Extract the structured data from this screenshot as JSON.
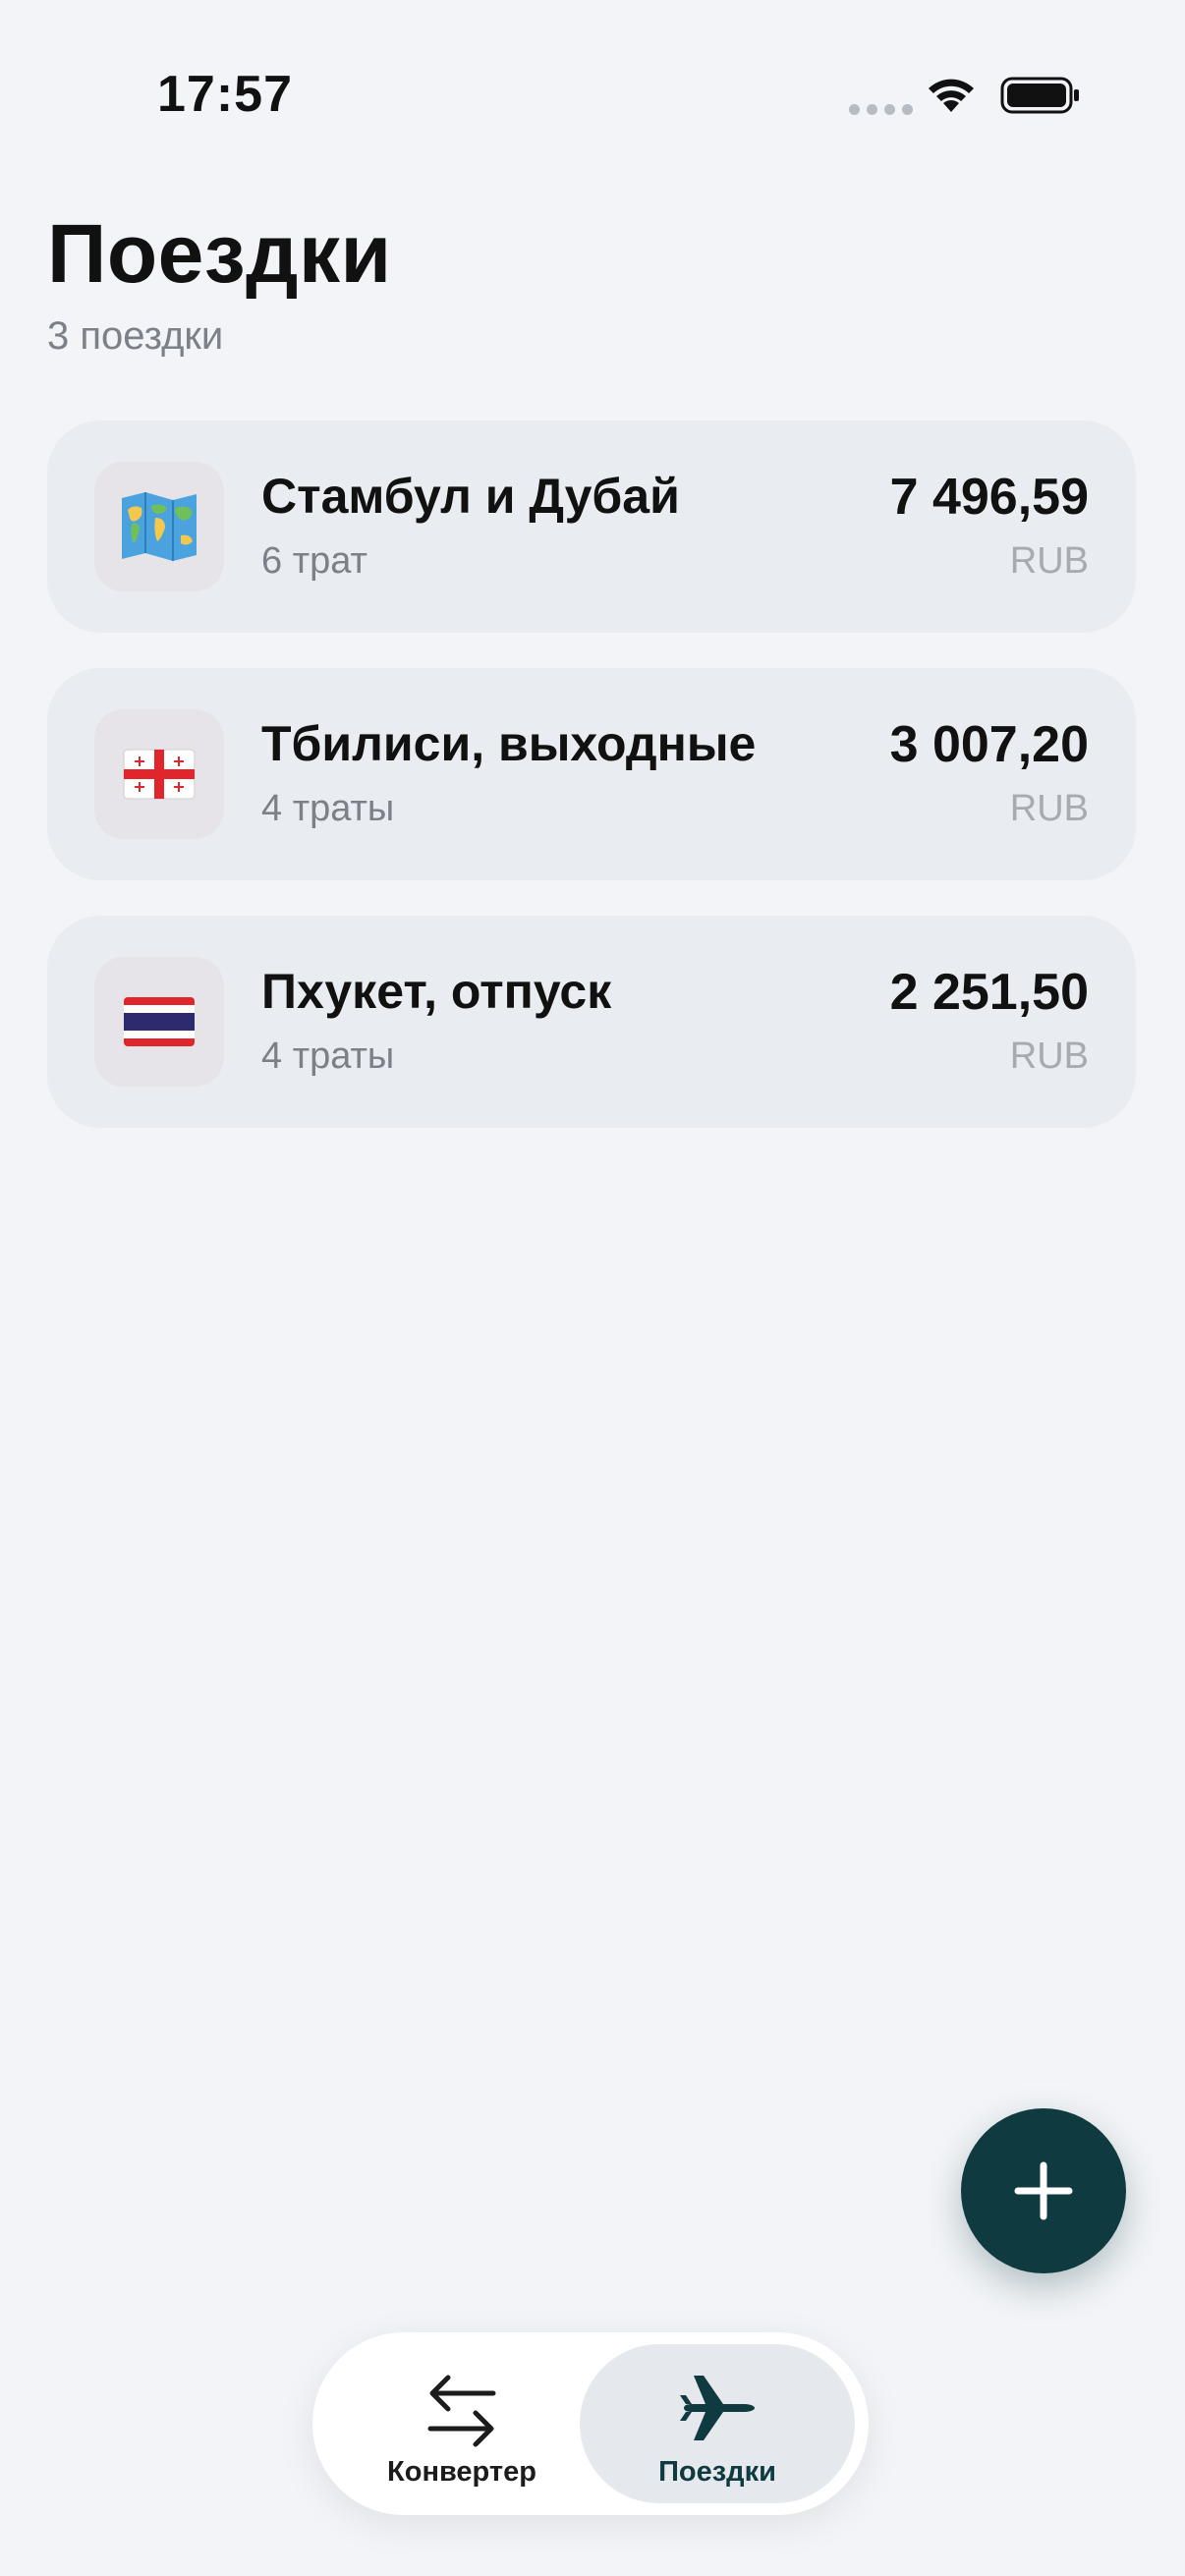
{
  "status_bar": {
    "time": "17:57",
    "icons": [
      "signal-dots-icon",
      "wifi-icon",
      "battery-icon"
    ]
  },
  "header": {
    "title": "Поездки",
    "subtitle": "3 поездки"
  },
  "trips": [
    {
      "name": "Стамбул и Дубай",
      "count": "6 трат",
      "amount": "7 496,59",
      "currency": "RUB",
      "icon": "world-map-icon"
    },
    {
      "name": "Тбилиси, выходные",
      "count": "4 траты",
      "amount": "3 007,20",
      "currency": "RUB",
      "icon": "georgia-flag-icon"
    },
    {
      "name": "Пхукет, отпуск",
      "count": "4 траты",
      "amount": "2 251,50",
      "currency": "RUB",
      "icon": "thailand-flag-icon"
    }
  ],
  "fab": {
    "icon": "plus-icon"
  },
  "tab_bar": {
    "tabs": [
      {
        "label": "Конвертер",
        "icon": "swap-arrows-icon",
        "selected": false
      },
      {
        "label": "Поездки",
        "icon": "airplane-icon",
        "selected": true
      }
    ]
  },
  "colors": {
    "background": "#f2f4f7",
    "card": "#e9ecf0",
    "accent": "#0f3a40",
    "secondary_text": "#7b8089"
  }
}
